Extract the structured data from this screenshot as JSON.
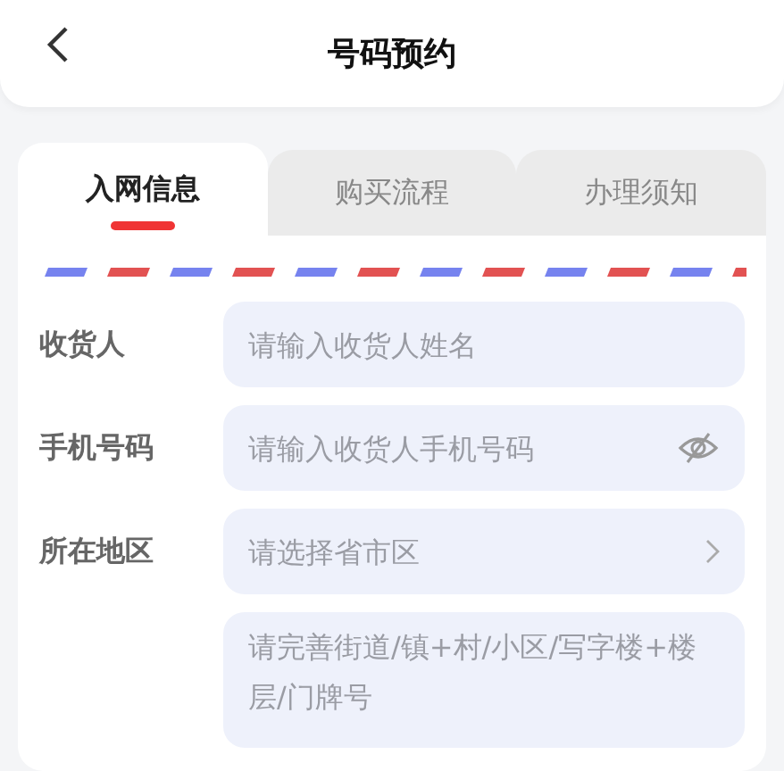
{
  "header": {
    "title": "号码预约"
  },
  "tabs": [
    {
      "label": "入网信息",
      "selected": true
    },
    {
      "label": "购买流程",
      "selected": false
    },
    {
      "label": "办理须知",
      "selected": false
    }
  ],
  "fields": [
    {
      "kind": "text",
      "label": "收货人",
      "placeholder": "请输入收货人姓名"
    },
    {
      "kind": "password",
      "label": "手机号码",
      "placeholder": "请输入收货人手机号码"
    },
    {
      "kind": "select",
      "label": "所在地区",
      "placeholder": "请选择省市区"
    },
    {
      "kind": "textarea",
      "placeholder": "请完善街道/镇+村/小区/写字楼+楼层/门牌号"
    }
  ]
}
